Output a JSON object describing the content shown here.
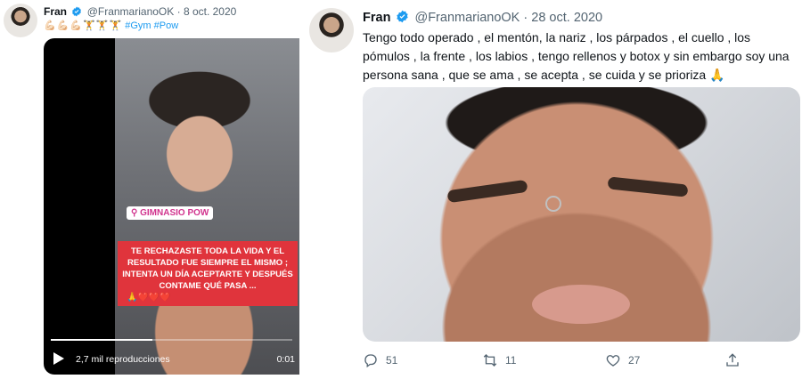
{
  "left_tweet": {
    "author_name": "Fran",
    "handle": "@FranmarianoOK",
    "separator": "·",
    "date": "8 oct. 2020",
    "emoji_line": "💪🏻💪🏻💪🏻🏋🏋🏋",
    "hashtags": "#Gym #Pow",
    "video": {
      "location_tag": "GIMNASIO POW",
      "caption": "TE RECHAZASTE TODA LA VIDA Y EL RESULTADO FUE SIEMPRE EL MISMO ; INTENTA UN DÍA ACEPTARTE Y DESPUÉS CONTAME QUÉ PASA ...",
      "caption_emoji": "🙏❤️❤️❤️",
      "views": "2,7 mil reproducciones",
      "timestamp": "0:01",
      "progress_fraction": 0.42
    }
  },
  "right_tweet": {
    "author_name": "Fran",
    "handle": "@FranmarianoOK",
    "separator": "·",
    "date": "28 oct. 2020",
    "text": "Tengo todo operado , el mentón, la nariz , los párpados , el cuello , los pómulos , la frente , los labios , tengo rellenos y botox y sin embargo soy una persona sana , que se ama , se acepta , se cuida y se prioriza",
    "text_emoji": "🙏",
    "replies": "51",
    "retweets": "11",
    "likes": "27"
  },
  "colors": {
    "verified": "#1d9bf0",
    "hashtag": "#1d9bf0",
    "muted": "#536471",
    "caption_bg": "#e0343c",
    "location_tag": "#d1348e"
  },
  "icons": [
    "verified-badge-icon",
    "play-icon",
    "reply-icon",
    "retweet-icon",
    "like-icon",
    "share-icon",
    "location-pin-icon"
  ]
}
